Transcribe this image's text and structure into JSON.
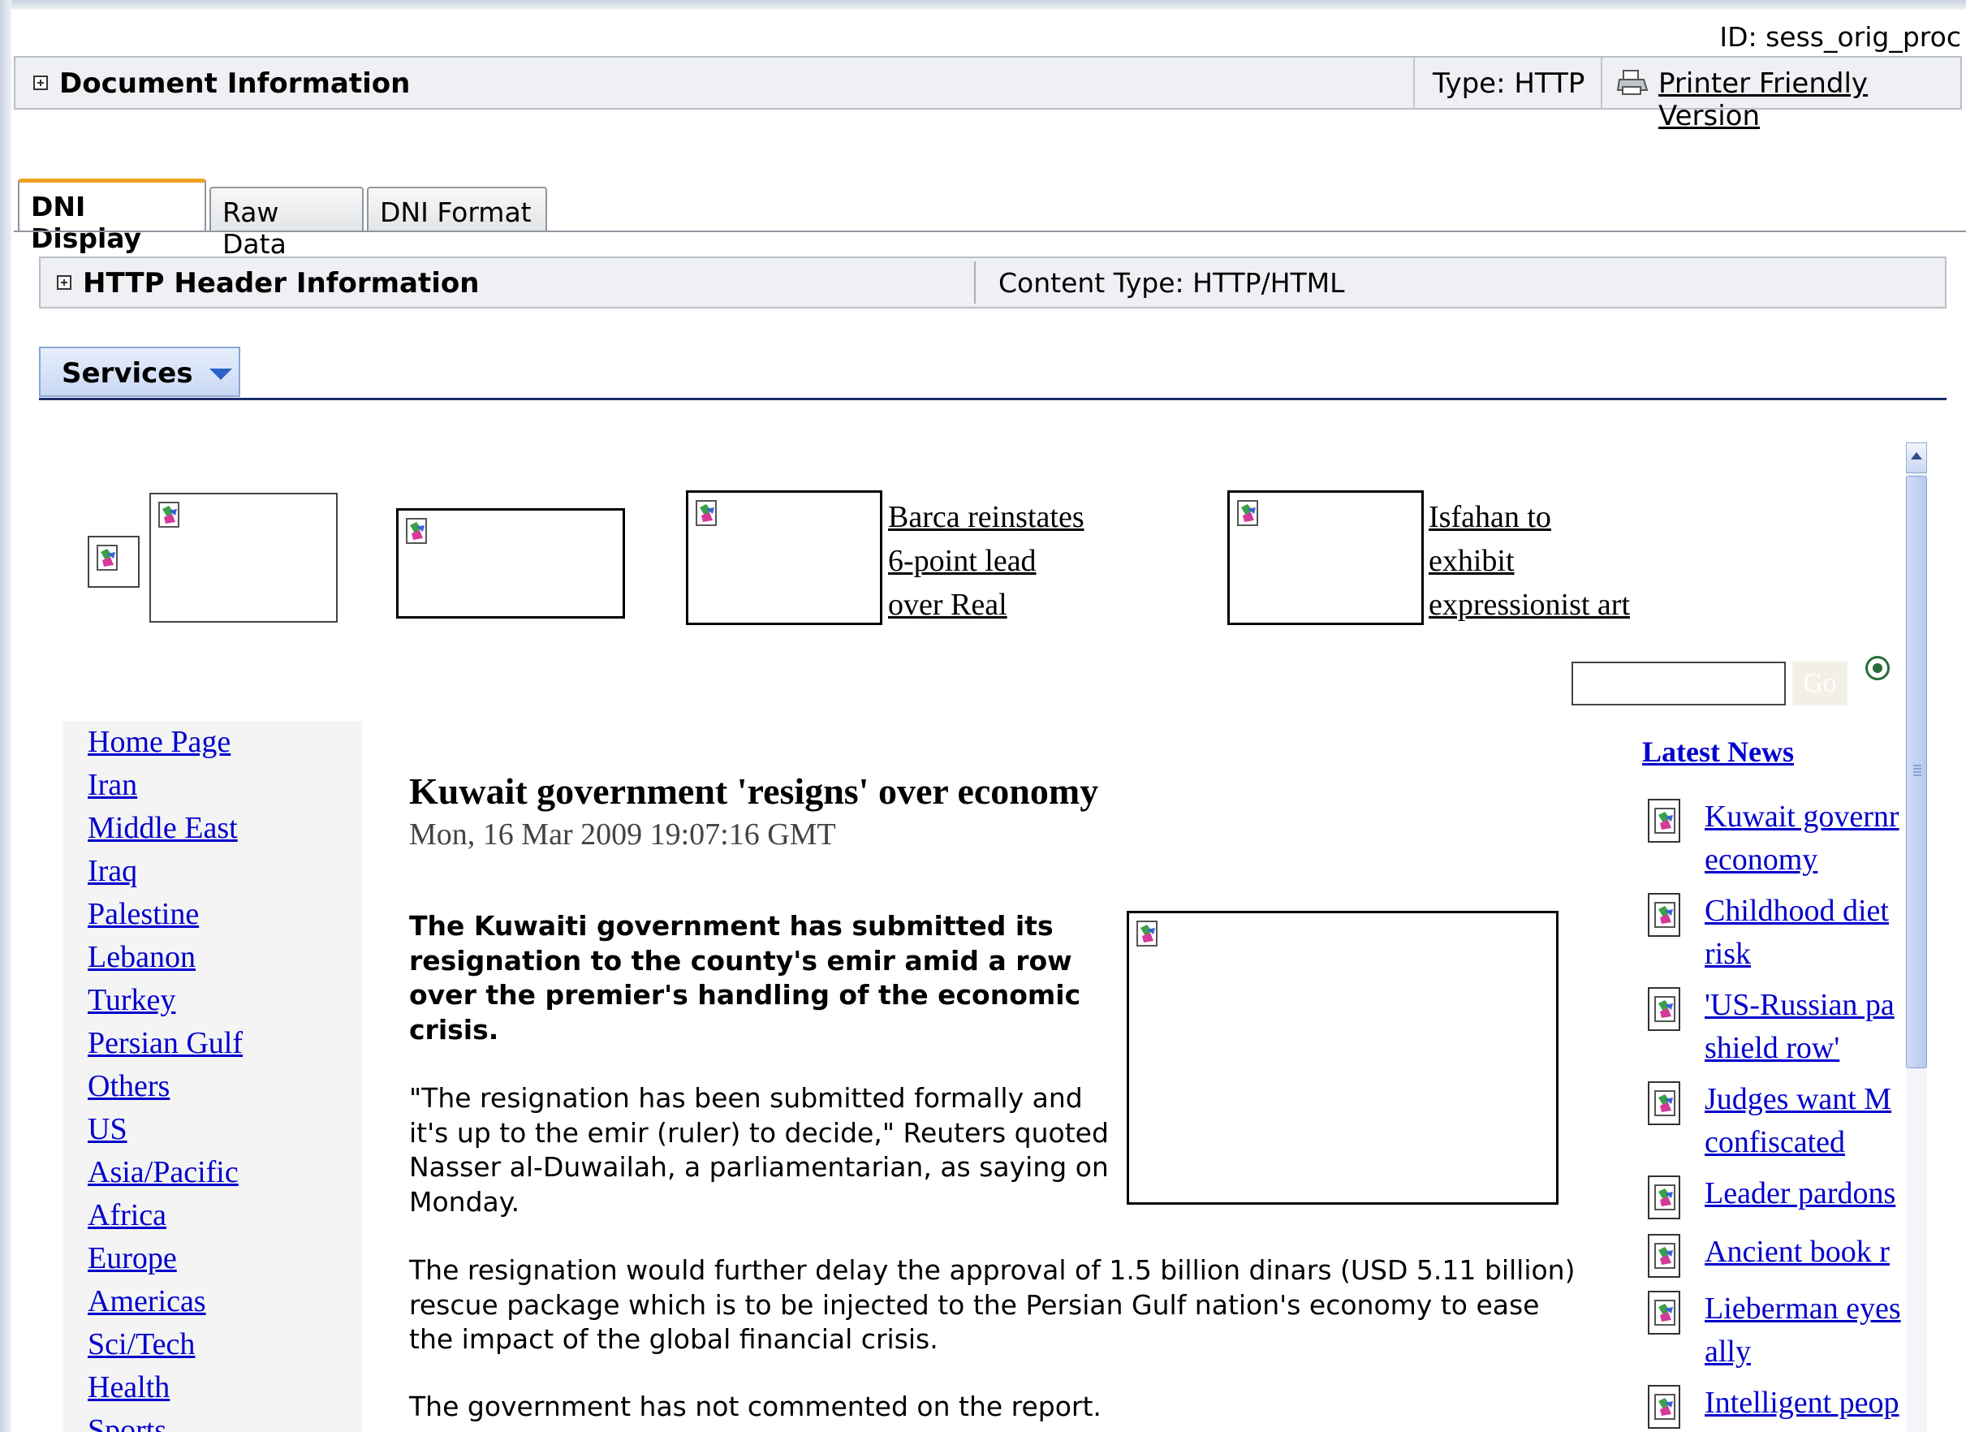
{
  "document": {
    "id_label": "ID: sess_orig_proc",
    "title": "Document Information",
    "type_label": "Type: HTTP",
    "printer_link": "Printer Friendly Version"
  },
  "tabs": [
    {
      "label": "DNI Display",
      "active": true
    },
    {
      "label": "Raw Data",
      "active": false
    },
    {
      "label": "DNI Format",
      "active": false
    }
  ],
  "http_header": {
    "title": "HTTP Header Information",
    "content_type": "Content Type: HTTP/HTML"
  },
  "services": {
    "label": "Services"
  },
  "promos": [
    {
      "title_lines": [
        "Barca reinstates",
        "6-point lead",
        "over Real"
      ]
    },
    {
      "title_lines": [
        "Isfahan to",
        "exhibit",
        "expressionist art"
      ]
    }
  ],
  "search": {
    "value": "",
    "go_label": "Go"
  },
  "nav": {
    "items": [
      "Home Page",
      "Iran",
      "Middle East",
      "Iraq",
      "Palestine",
      "Lebanon",
      "Turkey",
      "Persian Gulf",
      "Others",
      "US",
      "Asia/Pacific",
      "Africa",
      "Europe",
      "Americas",
      "Sci/Tech",
      "Health",
      "Sports"
    ]
  },
  "article": {
    "headline": "Kuwait government 'resigns' over economy",
    "dateline": "Mon, 16 Mar 2009 19:07:16 GMT",
    "lead": "The Kuwaiti government has submitted its resignation to the county's emir amid a row over the premier's handling of the economic crisis.",
    "paragraphs": [
      "\"The resignation has been submitted formally and it's up to the emir (ruler) to decide,\" Reuters quoted Nasser al-Duwailah, a parliamentarian, as saying on Monday.",
      "The resignation would further delay the approval of 1.5 billion dinars (USD 5.11 billion) rescue package which is to be injected to the Persian Gulf nation's economy to ease the impact of the global financial crisis.",
      "The government has not commented on the report."
    ]
  },
  "latest_news": {
    "title": "Latest News",
    "items": [
      [
        "Kuwait governr",
        "economy"
      ],
      [
        "Childhood diet",
        "risk"
      ],
      [
        "'US-Russian pa",
        "shield row'"
      ],
      [
        "Judges want M",
        "confiscated"
      ],
      [
        "Leader pardons"
      ],
      [
        "Ancient book r"
      ],
      [
        "Lieberman eyes",
        "ally"
      ],
      [
        "Intelligent peop"
      ]
    ]
  },
  "colors": {
    "link": "#0000cc",
    "tab_accent": "#f0a020",
    "services_bg": "#c9d8f4"
  }
}
